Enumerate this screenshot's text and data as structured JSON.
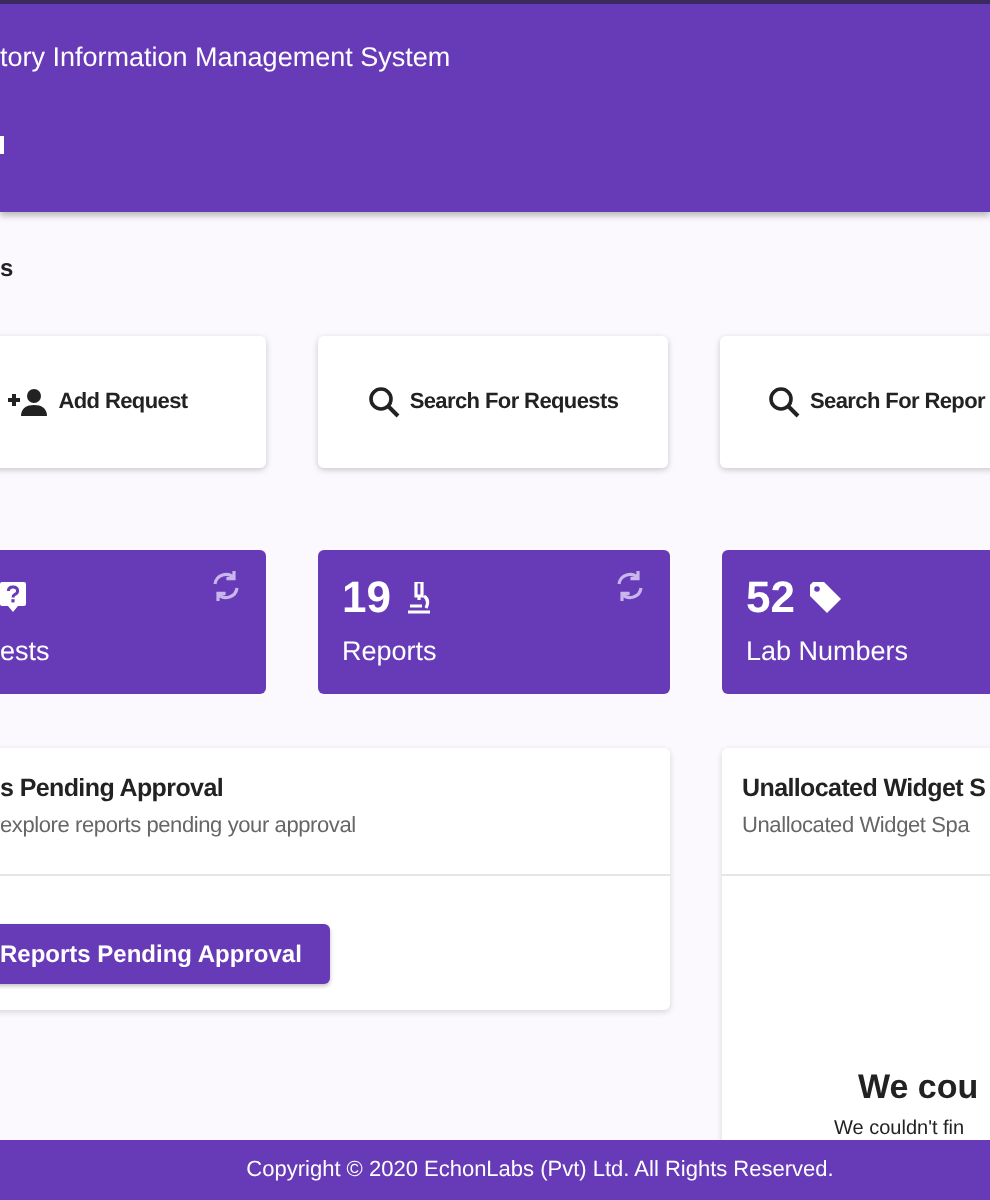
{
  "header": {
    "title": "tory Information Management System"
  },
  "section_title": "s",
  "actions": [
    {
      "label": "Add Request"
    },
    {
      "label": "Search For Requests"
    },
    {
      "label": "Search For Repor"
    }
  ],
  "stats": [
    {
      "label": "ests",
      "refresh": true
    },
    {
      "value": "19",
      "label": "Reports",
      "refresh": true
    },
    {
      "value": "52",
      "label": "Lab Numbers",
      "refresh": false
    }
  ],
  "panels": [
    {
      "title": "s Pending Approval",
      "subtitle": "explore reports pending your approval",
      "button": "Reports Pending Approval"
    },
    {
      "title": "Unallocated Widget S",
      "subtitle": "Unallocated Widget Spa",
      "empty_title": "We cou",
      "empty_text": "We couldn't fin"
    }
  ],
  "footer": "Copyright © 2020 EchonLabs (Pvt) Ltd. All Rights Reserved."
}
